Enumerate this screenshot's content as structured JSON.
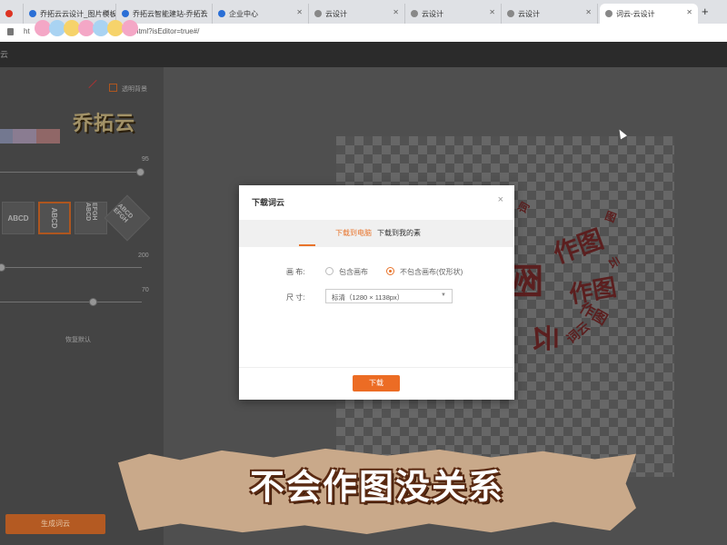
{
  "browser": {
    "tabs": [
      {
        "label": "",
        "fav": "#d32"
      },
      {
        "label": "乔拓云云设计_图片模板",
        "fav": "#2a6fd6"
      },
      {
        "label": "乔拓云智能建站-乔拓云",
        "fav": "#2a6fd6"
      },
      {
        "label": "企业中心",
        "fav": "#2a6fd6"
      },
      {
        "label": "云设计",
        "fav": "#888"
      },
      {
        "label": "云设计",
        "fav": "#888"
      },
      {
        "label": "云设计",
        "fav": "#888"
      },
      {
        "label": "词云-云设计",
        "fav": "#888"
      }
    ],
    "url_prefix": "ht",
    "url_suffix": "html?isEditor=true#/",
    "new_tab_icon": "+"
  },
  "app": {
    "header_label": "云"
  },
  "left_panel": {
    "transparent_bg_label": "透明背景",
    "logo_text": "乔拓云",
    "slider1_value": "95",
    "font_cards": [
      "ABCD",
      "ABCD",
      "EFGH ABCD",
      "ABCD EFGH"
    ],
    "slider2_value": "200",
    "slider3_value": "70",
    "reset_label": "恢复默认",
    "regenerate_label": "生成词云",
    "swatch_colors": [
      "#9aa0c0",
      "#b9a6c2",
      "#c08a8a"
    ]
  },
  "wordcloud": {
    "color": "#7a2a2a",
    "words": [
      "作图",
      "作图",
      "图",
      "云",
      "词云",
      "作图",
      "云",
      "词",
      "图"
    ]
  },
  "dialog": {
    "title": "下载词云",
    "close_icon": "×",
    "tab_computer": "下载到电脑",
    "tab_materials": "下载到我的素",
    "canvas_label": "画    布:",
    "option_include": "包含画布",
    "option_exclude": "不包含画布(仅形状)",
    "size_label": "尺    寸:",
    "size_value": "标清（1280 × 1138px）",
    "download_button": "下载"
  },
  "caption": "不会作图没关系",
  "colors": {
    "accent": "#ec6c24"
  }
}
